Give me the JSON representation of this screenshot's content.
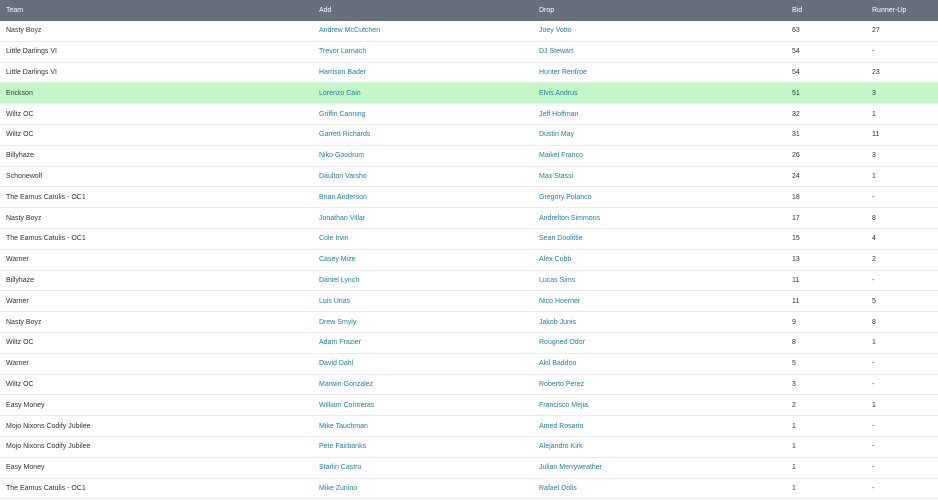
{
  "headers": {
    "team": "Team",
    "add": "Add",
    "drop": "Drop",
    "bid": "Bid",
    "runner_up": "Runner-Up"
  },
  "highlight_color": "#c3f7c8",
  "header_color": "#66707d",
  "link_color": "#1f7f9e",
  "rows": [
    {
      "team": "Nasty Boyz",
      "add": "Andrew McCutchen",
      "drop": "Joey Votto",
      "bid": "63",
      "runner_up": "27",
      "highlight": false
    },
    {
      "team": "Little Darlings VI",
      "add": "Trevor Larnach",
      "drop": "DJ Stewart",
      "bid": "54",
      "runner_up": "-",
      "highlight": false
    },
    {
      "team": "Little Darlings VI",
      "add": "Harrison Bader",
      "drop": "Hunter Renfroe",
      "bid": "54",
      "runner_up": "23",
      "highlight": false
    },
    {
      "team": "Erickson",
      "add": "Lorenzo Cain",
      "drop": "Elvis Andrus",
      "bid": "51",
      "runner_up": "3",
      "highlight": true
    },
    {
      "team": "Wiltz OC",
      "add": "Griffin Canning",
      "drop": "Jeff Hoffman",
      "bid": "32",
      "runner_up": "1",
      "highlight": false
    },
    {
      "team": "Wiltz OC",
      "add": "Garrett Richards",
      "drop": "Dustin May",
      "bid": "31",
      "runner_up": "11",
      "highlight": false
    },
    {
      "team": "Billyhaze",
      "add": "Niko Goodrum",
      "drop": "Maikel Franco",
      "bid": "26",
      "runner_up": "3",
      "highlight": false
    },
    {
      "team": "Schonewolf",
      "add": "Daulton Varsho",
      "drop": "Max Stassi",
      "bid": "24",
      "runner_up": "1",
      "highlight": false
    },
    {
      "team": "The Eamus Catulis - OC1",
      "add": "Brian Anderson",
      "drop": "Gregory Polanco",
      "bid": "18",
      "runner_up": "-",
      "highlight": false
    },
    {
      "team": "Nasty Boyz",
      "add": "Jonathan Villar",
      "drop": "Andrelton Simmons",
      "bid": "17",
      "runner_up": "8",
      "highlight": false
    },
    {
      "team": "The Eamus Catulis - OC1",
      "add": "Cole Irvin",
      "drop": "Sean Doolittle",
      "bid": "15",
      "runner_up": "4",
      "highlight": false
    },
    {
      "team": "Warner",
      "add": "Casey Mize",
      "drop": "Alex Cobb",
      "bid": "13",
      "runner_up": "2",
      "highlight": false
    },
    {
      "team": "Billyhaze",
      "add": "Daniel Lynch",
      "drop": "Lucas Sims",
      "bid": "11",
      "runner_up": "-",
      "highlight": false
    },
    {
      "team": "Warner",
      "add": "Luis Urias",
      "drop": "Nico Hoerner",
      "bid": "11",
      "runner_up": "5",
      "highlight": false
    },
    {
      "team": "Nasty Boyz",
      "add": "Drew Smyly",
      "drop": "Jakob Junis",
      "bid": "9",
      "runner_up": "8",
      "highlight": false
    },
    {
      "team": "Wiltz OC",
      "add": "Adam Frazier",
      "drop": "Rougned Odor",
      "bid": "8",
      "runner_up": "1",
      "highlight": false
    },
    {
      "team": "Warner",
      "add": "David Dahl",
      "drop": "Akil Baddoo",
      "bid": "5",
      "runner_up": "-",
      "highlight": false
    },
    {
      "team": "Wiltz OC",
      "add": "Marwin Gonzalez",
      "drop": "Roberto Perez",
      "bid": "3",
      "runner_up": "-",
      "highlight": false
    },
    {
      "team": "Easy Money",
      "add": "William Contreras",
      "drop": "Francisco Mejia",
      "bid": "2",
      "runner_up": "1",
      "highlight": false
    },
    {
      "team": "Mojo Nixons Codify Jubilee",
      "add": "Mike Tauchman",
      "drop": "Amed Rosario",
      "bid": "1",
      "runner_up": "-",
      "highlight": false
    },
    {
      "team": "Mojo Nixons Codify Jubilee",
      "add": "Pete Fairbanks",
      "drop": "Alejandro Kirk",
      "bid": "1",
      "runner_up": "-",
      "highlight": false
    },
    {
      "team": "Easy Money",
      "add": "Starlin Castro",
      "drop": "Julian Merryweather",
      "bid": "1",
      "runner_up": "-",
      "highlight": false
    },
    {
      "team": "The Eamus Catulis - OC1",
      "add": "Mike Zunino",
      "drop": "Rafael Dolis",
      "bid": "1",
      "runner_up": "-",
      "highlight": false
    }
  ]
}
